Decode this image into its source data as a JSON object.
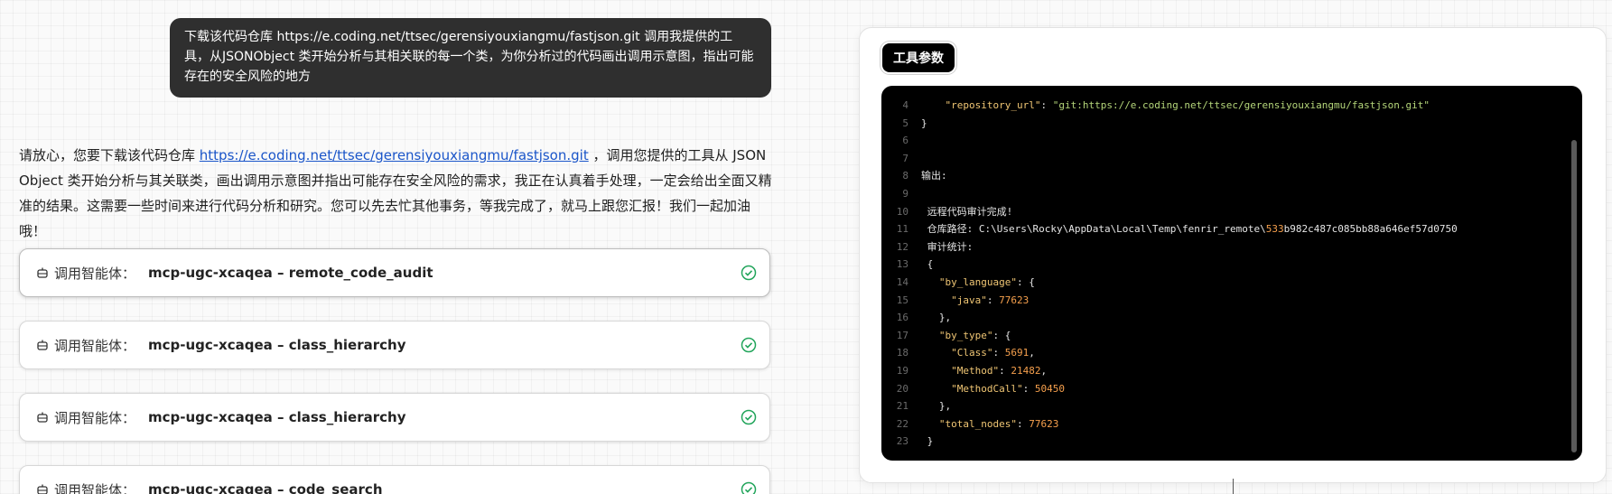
{
  "user_message": "下载该代码仓库 https://e.coding.net/ttsec/gerensiyouxiangmu/fastjson.git 调用我提供的工具，从JSONObject 类开始分析与其相关联的每一个类，为你分析过的代码画出调用示意图，指出可能存在的安全风险的地方",
  "assistant": {
    "before_link": "请放心，您要下载该代码仓库 ",
    "link_text": "https://e.coding.net/ttsec/gerensiyouxiangmu/fastjson.git",
    "after_link": " ，调用您提供的工具从 JSON Object 类开始分析与其关联类，画出调用示意图并指出可能存在安全风险的需求，我正在认真着手处理，一定会给出全面又精准的结果。这需要一些时间来进行代码分析和研究。您可以先去忙其他事务，等我完成了，就马上跟您汇报！我们一起加油哦！"
  },
  "tool_calls": [
    {
      "prefix": "调用智能体：",
      "name": "mcp-ugc-xcaqea – remote_code_audit",
      "icon": "robot-icon",
      "status": "done"
    },
    {
      "prefix": "调用智能体：",
      "name": "mcp-ugc-xcaqea – class_hierarchy",
      "icon": "robot-icon",
      "status": "done"
    },
    {
      "prefix": "调用智能体：",
      "name": "mcp-ugc-xcaqea – class_hierarchy",
      "icon": "robot-icon",
      "status": "done"
    },
    {
      "prefix": "调用智能体：",
      "name": "mcp-ugc-xcaqea – code_search",
      "icon": "robot-icon",
      "status": "done"
    }
  ],
  "panel": {
    "badge": "工具参数",
    "code_lines": [
      {
        "n": "4",
        "t": "    \"repository_url\": \"git:https://e.coding.net/ttsec/gerensiyouxiangmu/fastjson.git\""
      },
      {
        "n": "5",
        "t": "}"
      },
      {
        "n": "6",
        "t": ""
      },
      {
        "n": "7",
        "t": ""
      },
      {
        "n": "8",
        "t": "输出:"
      },
      {
        "n": "9",
        "t": ""
      },
      {
        "n": "10",
        "t": " 远程代码审计完成!"
      },
      {
        "n": "11",
        "t": " 仓库路径: C:\\Users\\Rocky\\AppData\\Local\\Temp\\fenrir_remote\\533b982c487c085bb88a646ef57d0750"
      },
      {
        "n": "12",
        "t": " 审计统计:"
      },
      {
        "n": "13",
        "t": " {"
      },
      {
        "n": "14",
        "t": "   \"by_language\": {"
      },
      {
        "n": "15",
        "t": "     \"java\": 77623"
      },
      {
        "n": "16",
        "t": "   },"
      },
      {
        "n": "17",
        "t": "   \"by_type\": {"
      },
      {
        "n": "18",
        "t": "     \"Class\": 5691,"
      },
      {
        "n": "19",
        "t": "     \"Method\": 21482,"
      },
      {
        "n": "20",
        "t": "     \"MethodCall\": 50450"
      },
      {
        "n": "21",
        "t": "   },"
      },
      {
        "n": "22",
        "t": "   \"total_nodes\": 77623"
      },
      {
        "n": "23",
        "t": " }"
      }
    ]
  },
  "colors": {
    "link": "#1a55c9",
    "check": "#22a55b",
    "bubble": "#2f2f2f",
    "code_bg": "#000000"
  }
}
